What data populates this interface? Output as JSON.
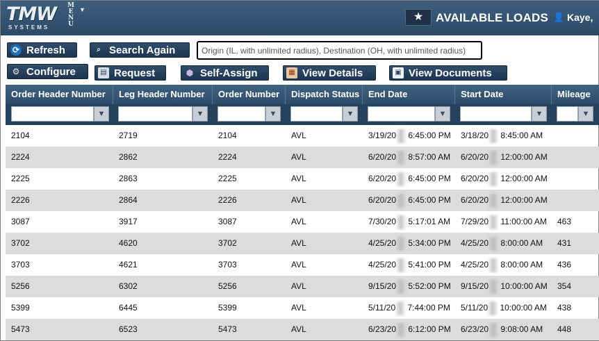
{
  "header": {
    "logo_text": "TMW",
    "logo_sub": "SYSTEMS",
    "menu_label": "MENU",
    "menu_caret": "▼",
    "favorite_icon": "star-icon",
    "page_title": "AVAILABLE LOADS",
    "user_name": "Kaye,"
  },
  "toolbar": {
    "refresh": "Refresh",
    "search_again": "Search Again",
    "search_criteria": "Origin (IL, with unlimited radius), Destination (OH, with unlimited radius)",
    "configure": "Configure",
    "request": "Request",
    "self_assign": "Self-Assign",
    "view_details": "View Details",
    "view_documents": "View Documents"
  },
  "grid": {
    "columns": [
      "Order Header Number",
      "Leg Header Number",
      "Order Number",
      "Dispatch Status",
      "End Date",
      "Start Date",
      "Mileage"
    ],
    "rows": [
      {
        "ohn": "2104",
        "lhn": "2719",
        "on": "2104",
        "status": "AVL",
        "end_a": "3/19/20",
        "end_b": "6:45:00 PM",
        "start_a": "3/18/20",
        "start_b": "8:45:00 AM",
        "mileage": ""
      },
      {
        "ohn": "2224",
        "lhn": "2862",
        "on": "2224",
        "status": "AVL",
        "end_a": "6/20/20",
        "end_b": "8:57:00 AM",
        "start_a": "6/20/20",
        "start_b": "12:00:00 AM",
        "mileage": ""
      },
      {
        "ohn": "2225",
        "lhn": "2863",
        "on": "2225",
        "status": "AVL",
        "end_a": "6/20/20",
        "end_b": "6:45:00 PM",
        "start_a": "6/20/20",
        "start_b": "12:00:00 AM",
        "mileage": ""
      },
      {
        "ohn": "2226",
        "lhn": "2864",
        "on": "2226",
        "status": "AVL",
        "end_a": "6/20/20",
        "end_b": "6:45:00 PM",
        "start_a": "6/20/20",
        "start_b": "12:00:00 AM",
        "mileage": ""
      },
      {
        "ohn": "3087",
        "lhn": "3917",
        "on": "3087",
        "status": "AVL",
        "end_a": "7/30/20",
        "end_b": "5:17:01 AM",
        "start_a": "7/29/20",
        "start_b": "11:00:00 AM",
        "mileage": "463"
      },
      {
        "ohn": "3702",
        "lhn": "4620",
        "on": "3702",
        "status": "AVL",
        "end_a": "4/25/20",
        "end_b": "5:34:00 PM",
        "start_a": "4/25/20",
        "start_b": "8:00:00 AM",
        "mileage": "431"
      },
      {
        "ohn": "3703",
        "lhn": "4621",
        "on": "3703",
        "status": "AVL",
        "end_a": "4/25/20",
        "end_b": "5:41:00 PM",
        "start_a": "4/25/20",
        "start_b": "8:00:00 AM",
        "mileage": "436"
      },
      {
        "ohn": "5256",
        "lhn": "6302",
        "on": "5256",
        "status": "AVL",
        "end_a": "9/15/20",
        "end_b": "5:52:00 PM",
        "start_a": "9/15/20",
        "start_b": "10:00:00 AM",
        "mileage": "354"
      },
      {
        "ohn": "5399",
        "lhn": "6445",
        "on": "5399",
        "status": "AVL",
        "end_a": "5/11/20",
        "end_b": "7:44:00 PM",
        "start_a": "5/11/20",
        "start_b": "10:00:00 AM",
        "mileage": "438"
      },
      {
        "ohn": "5473",
        "lhn": "6523",
        "on": "5473",
        "status": "AVL",
        "end_a": "6/23/20",
        "end_b": "6:12:00 PM",
        "start_a": "6/23/20",
        "start_b": "9:08:00 AM",
        "mileage": "448"
      }
    ]
  },
  "colors": {
    "header_bg": "#2c4a66",
    "button_bg": "#1d3550",
    "alt_row": "#dcdcdc"
  }
}
